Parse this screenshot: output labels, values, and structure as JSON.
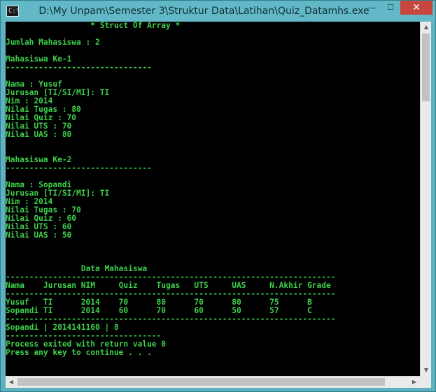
{
  "window": {
    "title": "D:\\My Unpam\\Semester 3\\Struktur Data\\Latihan\\Quiz_Datamhs.exe",
    "icon": "console-icon",
    "icon_glyph": "C:\\",
    "minimize_label": "—",
    "maximize_label": "☐",
    "close_label": "✕"
  },
  "console": {
    "lines": [
      "                  * Struct Of Array *",
      "",
      "Jumlah Mahasiswa : 2",
      "",
      "Mahasiswa Ke-1",
      "-------------------------------",
      "",
      "Nama : Yusuf",
      "Jurusan [TI/SI/MI]: TI",
      "Nim : 2014",
      "Nilai Tugas : 80",
      "Nilai Quiz : 70",
      "Nilai UTS : 70",
      "Nilai UAS : 80",
      "",
      "",
      "Mahasiswa Ke-2",
      "-------------------------------",
      "",
      "Nama : Sopandi",
      "Jurusan [TI/SI/MI]: TI",
      "Nim : 2014",
      "Nilai Tugas : 70",
      "Nilai Quiz : 60",
      "Nilai UTS : 60",
      "Nilai UAS : 50",
      "",
      "",
      "",
      "                Data Mahasiswa",
      "----------------------------------------------------------------------",
      "Nama    Jurusan NIM     Quiz    Tugas   UTS     UAS     N.Akhir Grade",
      "----------------------------------------------------------------------",
      "Yusuf   TI      2014    70      80      70      80      75      B",
      "Sopandi TI      2014    60      70      60      50      57      C",
      "----------------------------------------------------------------------",
      "Sopandi | 2014141160 | 8",
      "---------------------------------",
      "Process exited with return value 0",
      "Press any key to continue . . ."
    ]
  },
  "scrollbars": {
    "up_arrow": "▲",
    "down_arrow": "▼",
    "left_arrow": "◀",
    "right_arrow": "▶"
  },
  "colors": {
    "console_text": "#3dd04b",
    "console_background": "#000000",
    "titlebar": "#63b8c8",
    "close_button": "#c7463d"
  }
}
